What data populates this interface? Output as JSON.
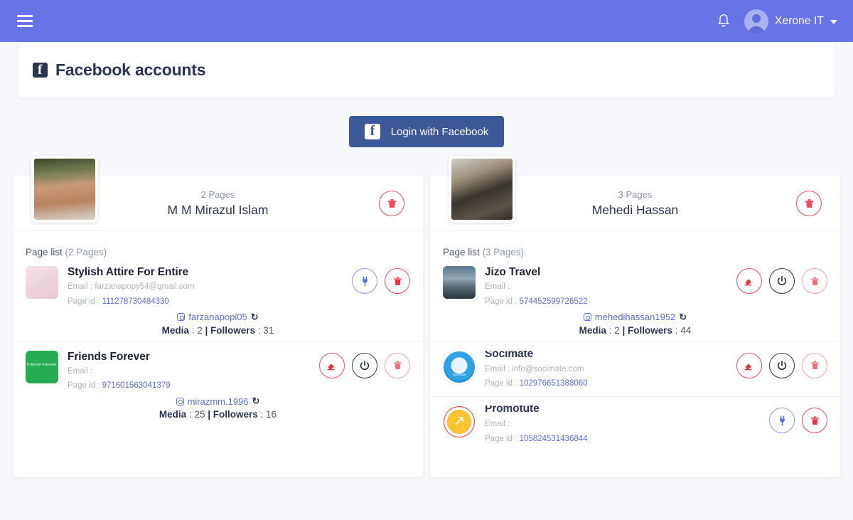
{
  "topbar": {
    "menu_icon": "hamburger-icon",
    "bell_icon": "bell-icon",
    "user_name": "Xerone IT"
  },
  "header": {
    "icon": "facebook-icon",
    "title": "Facebook accounts"
  },
  "login": {
    "icon": "facebook-icon",
    "label": "Login with Facebook"
  },
  "accounts": [
    {
      "pages_count": "2 Pages",
      "name": "M M Mirazul Islam",
      "delete_icon": "trash-icon",
      "page_list_label": "Page list",
      "page_list_count": "(2 Pages)",
      "pages": [
        {
          "name": "Stylish Attire For Entire",
          "email_label": "Email : farzanapopy54@gmail.com",
          "page_id_label": "Page id : ",
          "page_id": "111278730484330",
          "instagram": "farzanapopi05",
          "media_label": "Media",
          "media": "2",
          "followers_label": "Followers",
          "followers": "31",
          "actions": [
            "plug-icon",
            "trash-icon"
          ]
        },
        {
          "name": "Friends Forever",
          "email_label": "Email :",
          "page_id_label": "Page id : ",
          "page_id": "971601563041379",
          "instagram": "mirazmm.1996",
          "media_label": "Media",
          "media": "25",
          "followers_label": "Followers",
          "followers": "16",
          "actions": [
            "unplug-icon",
            "power-icon",
            "trash-icon"
          ]
        }
      ]
    },
    {
      "pages_count": "3 Pages",
      "name": "Mehedi Hassan",
      "delete_icon": "trash-icon",
      "page_list_label": "Page list",
      "page_list_count": "(3 Pages)",
      "pages": [
        {
          "name": "Jizo Travel",
          "email_label": "Email :",
          "page_id_label": "Page id : ",
          "page_id": "574452599726522",
          "instagram": "mehedihassan1952",
          "media_label": "Media",
          "media": "2",
          "followers_label": "Followers",
          "followers": "44",
          "actions": [
            "unplug-icon",
            "power-icon",
            "trash-icon"
          ]
        },
        {
          "name": "Socimate",
          "email_label": "Email : info@socimate.com",
          "page_id_label": "Page id : ",
          "page_id": "102976651388060",
          "actions": [
            "unplug-icon",
            "power-icon",
            "trash-icon"
          ]
        },
        {
          "name": "Promotute",
          "email_label": "Email :",
          "page_id_label": "Page id : ",
          "page_id": "105824531436844",
          "actions": [
            "plug-icon",
            "trash-icon"
          ]
        }
      ]
    }
  ],
  "colors": {
    "topbar": "#6674e8",
    "facebook_blue": "#3b5998",
    "link_blue": "#5b6fd6",
    "danger_red": "#ef4d5e",
    "page_bg": "#f7f8fb"
  }
}
